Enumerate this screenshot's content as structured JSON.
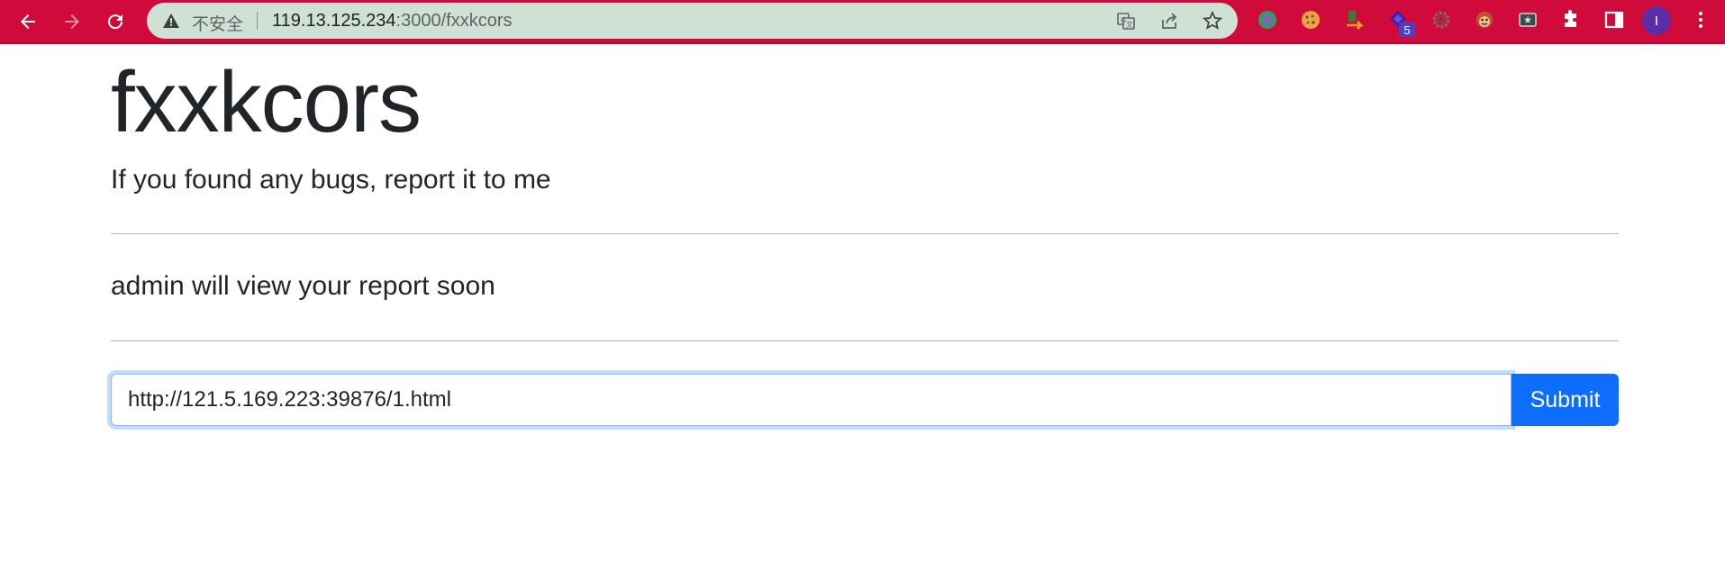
{
  "browser": {
    "security_label": "不安全",
    "url_host": "119.13.125.234",
    "url_path": ":3000/fxxkcors",
    "extension_badge": "5",
    "profile_initial": "I",
    "toolbar_color": "#d10a3c",
    "omnibox_color": "#cfe1d5",
    "icons": [
      "back-icon",
      "forward-icon",
      "reload-icon",
      "warning-icon",
      "translate-icon",
      "share-icon",
      "star-icon",
      "extension-globe-icon",
      "cookie-icon",
      "extension-arrow-icon",
      "extension-diamond-icon",
      "gear-icon",
      "extension-monkey-icon",
      "screenshot-icon",
      "puzzle-icon",
      "sidepanel-icon",
      "menu-icon"
    ]
  },
  "page": {
    "title": "fxxkcors",
    "lead": "If you found any bugs, report it to me",
    "info": "admin will view your report soon",
    "input_value": "http://121.5.169.223:39876/1.html",
    "submit_label": "Submit",
    "accent_color": "#0d6efd"
  }
}
